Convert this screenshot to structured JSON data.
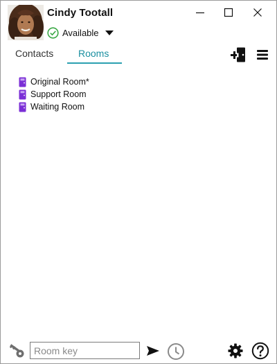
{
  "user": {
    "name": "Cindy  Tootall",
    "status": "Available"
  },
  "window_controls": {
    "minimize_icon": "minimize-icon",
    "maximize_icon": "maximize-icon",
    "close_icon": "close-icon"
  },
  "tabs": [
    {
      "label": "Contacts",
      "active": false
    },
    {
      "label": "Rooms",
      "active": true
    }
  ],
  "toolbar": {
    "add_room_icon": "add-room-icon",
    "menu_icon": "hamburger-menu-icon"
  },
  "rooms": [
    {
      "label": "Original Room*"
    },
    {
      "label": "Support Room"
    },
    {
      "label": "Waiting Room"
    }
  ],
  "footer": {
    "room_key_placeholder": "Room key",
    "room_key_value": ""
  },
  "colors": {
    "accent": "#2aa0b0",
    "room_icon": "#7b2fd6",
    "status_green": "#3aa845"
  }
}
